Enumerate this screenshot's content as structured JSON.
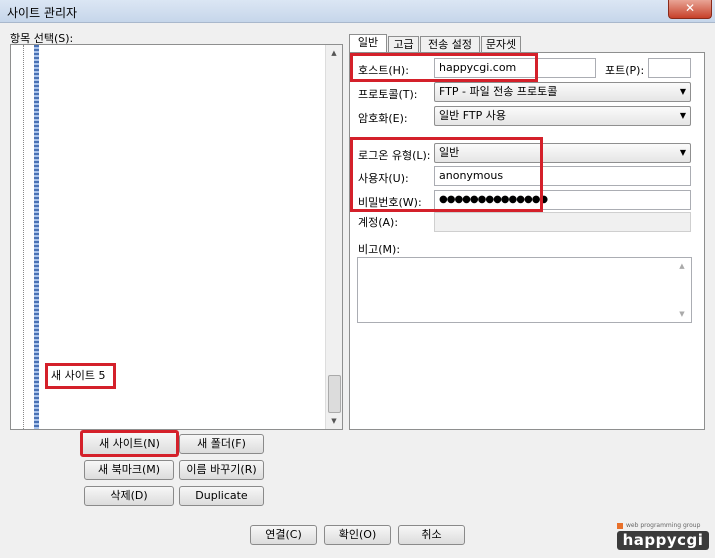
{
  "window": {
    "title": "사이트 관리자",
    "close_glyph": "✕"
  },
  "tree": {
    "label": "항목 선택(S):",
    "selected_item": "새 사이트 5"
  },
  "buttons": {
    "new_site": "새 사이트(N)",
    "new_folder": "새 폴더(F)",
    "new_bookmark": "새 북마크(M)",
    "rename": "이름 바꾸기(R)",
    "delete": "삭제(D)",
    "duplicate": "Duplicate"
  },
  "tabs": [
    "일반",
    "고급",
    "전송 설정",
    "문자셋"
  ],
  "general": {
    "host_label": "호스트(H):",
    "host_value": "happycgi.com",
    "port_label": "포트(P):",
    "port_value": "",
    "protocol_label": "프로토콜(T):",
    "protocol_value": "FTP - 파일 전송 프로토콜",
    "encryption_label": "암호화(E):",
    "encryption_value": "일반 FTP 사용",
    "logon_type_label": "로그온 유형(L):",
    "logon_type_value": "일반",
    "user_label": "사용자(U):",
    "user_value": "anonymous",
    "password_label": "비밀번호(W):",
    "password_value": "●●●●●●●●●●●●●●",
    "account_label": "계정(A):",
    "account_value": "",
    "comments_label": "비고(M):",
    "comments_value": ""
  },
  "footer": {
    "connect": "연결(C)",
    "ok": "확인(O)",
    "cancel": "취소"
  },
  "logo": {
    "tagline": "web programming group",
    "name": "happycgi"
  },
  "colors": {
    "highlight": "#d4202a",
    "logo_bg": "#3b3b3b"
  }
}
